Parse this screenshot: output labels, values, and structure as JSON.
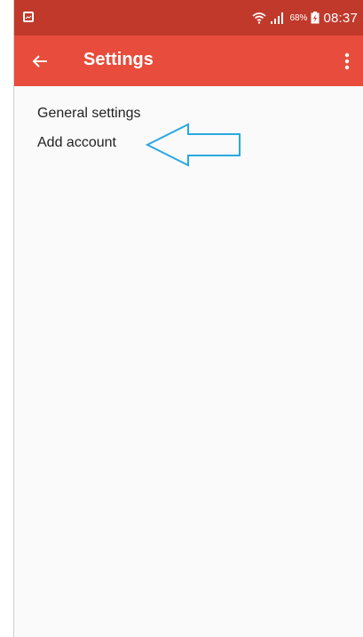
{
  "status_bar": {
    "battery_percent": "68%",
    "time": "08:37",
    "icons": [
      "screenshot-icon",
      "wifi-icon",
      "signal-icon",
      "battery-icon"
    ]
  },
  "app_bar": {
    "title": "Settings",
    "back_icon": "back-arrow-icon",
    "menu_icon": "more-vert-icon"
  },
  "settings": {
    "items": [
      {
        "label": "General settings"
      },
      {
        "label": "Add account"
      }
    ]
  },
  "colors": {
    "status_bar": "#c0392b",
    "app_bar": "#e74c3c",
    "annotation_arrow": "#29a8e0"
  }
}
